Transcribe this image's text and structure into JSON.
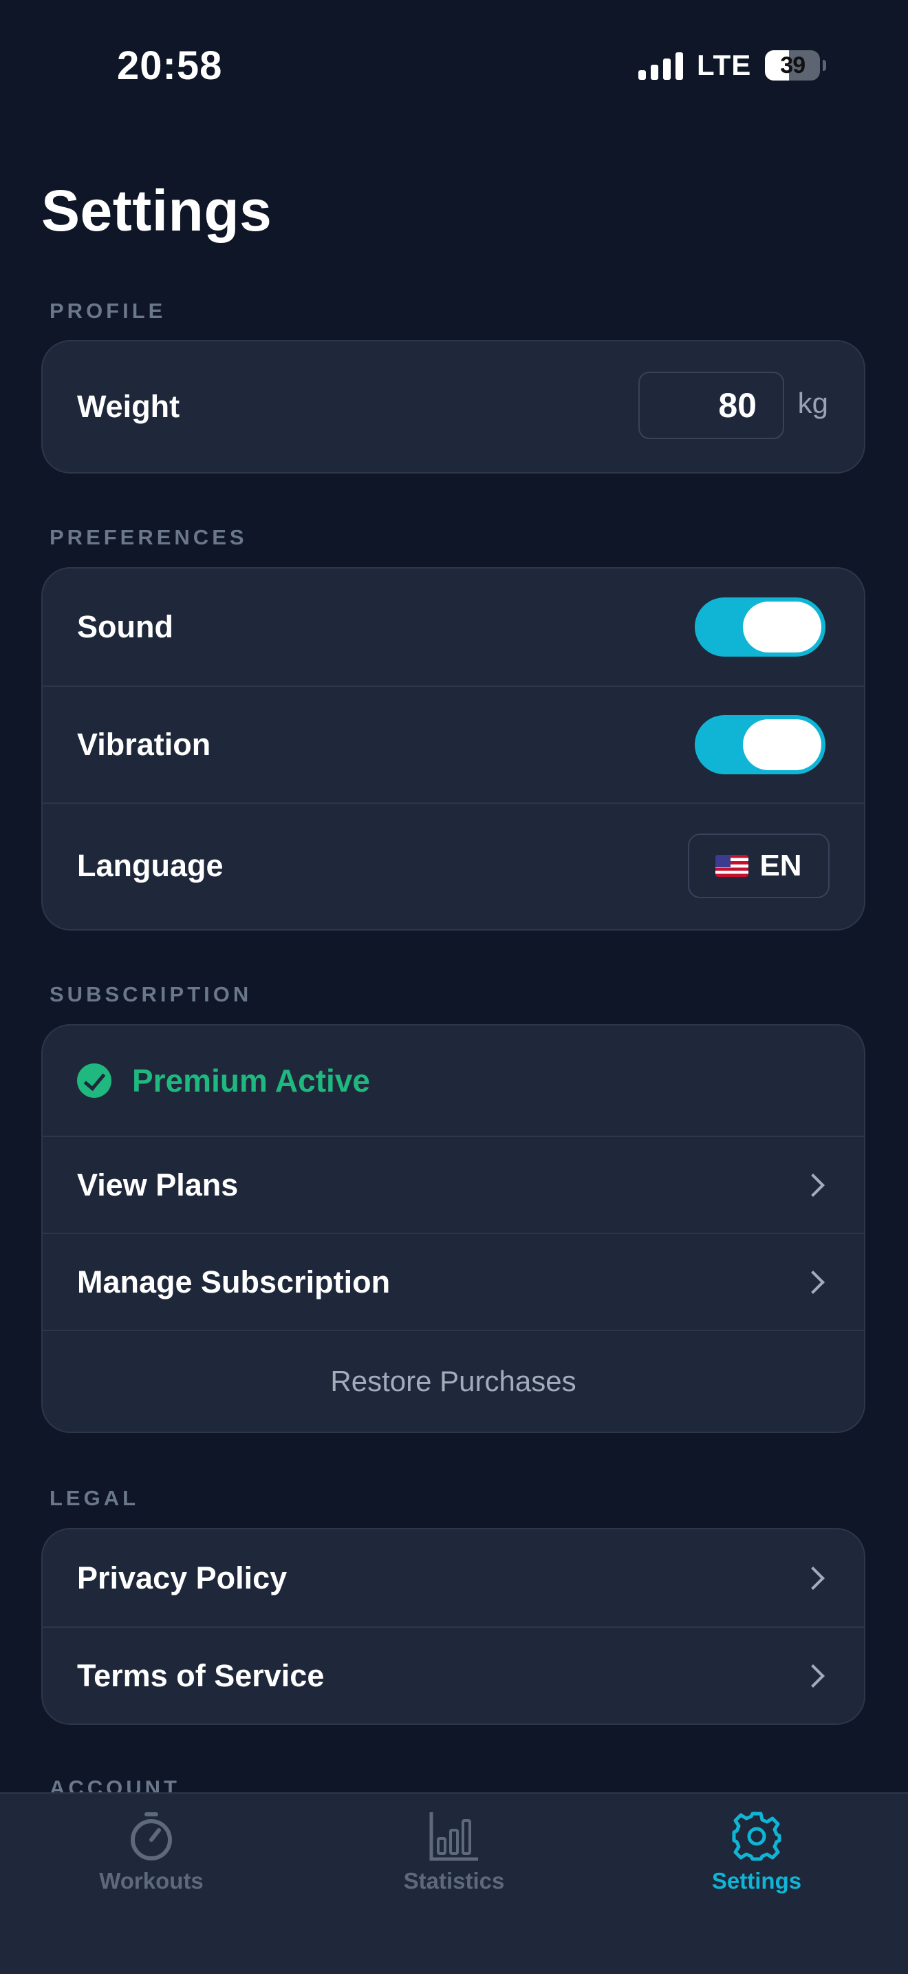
{
  "status_bar": {
    "time": "20:58",
    "network": "LTE",
    "battery": "39"
  },
  "page_title": "Settings",
  "profile": {
    "section_label": "PROFILE",
    "weight_label": "Weight",
    "weight_value": "80",
    "weight_unit": "kg"
  },
  "preferences": {
    "section_label": "PREFERENCES",
    "sound_label": "Sound",
    "sound_on": true,
    "vibration_label": "Vibration",
    "vibration_on": true,
    "language_label": "Language",
    "language_value": "EN",
    "language_flag": "us-flag-icon"
  },
  "subscription": {
    "section_label": "SUBSCRIPTION",
    "status": "Premium Active",
    "view_plans": "View Plans",
    "manage": "Manage Subscription",
    "restore": "Restore Purchases"
  },
  "legal": {
    "section_label": "LEGAL",
    "privacy": "Privacy Policy",
    "terms": "Terms of Service"
  },
  "account": {
    "section_label": "ACCOUNT"
  },
  "tabbar": {
    "tabs": [
      {
        "label": "Workouts",
        "icon": "stopwatch-icon",
        "active": false
      },
      {
        "label": "Statistics",
        "icon": "bar-chart-icon",
        "active": false
      },
      {
        "label": "Settings",
        "icon": "gear-icon",
        "active": true
      }
    ]
  },
  "colors": {
    "background": "#0e1627",
    "card": "#1f283a",
    "accent": "#10b5d6",
    "success": "#1fb87f",
    "muted": "#6b778b"
  }
}
